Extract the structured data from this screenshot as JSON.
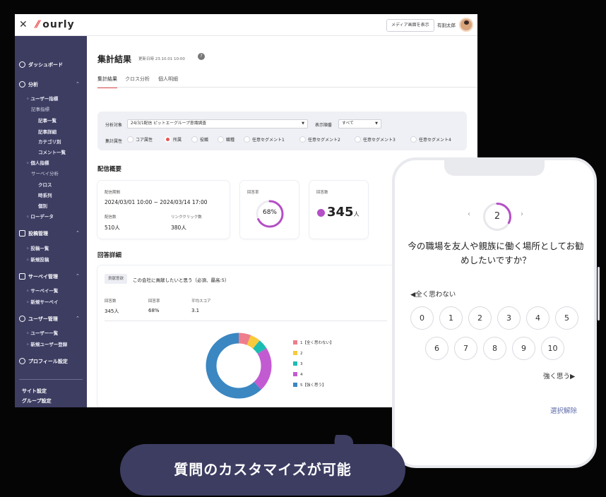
{
  "topbar": {
    "logo_text": "ourly",
    "media_button": "メディア画面を表示",
    "user_name": "有割太郎"
  },
  "sidebar": {
    "dashboard": "ダッシュボード",
    "analysis": "分析",
    "user_metrics": "ユーザー指標",
    "article_metrics": "記事指標",
    "article_list": "記事一覧",
    "article_detail": "記事詳細",
    "by_category": "カテゴリ別",
    "comment_list": "コメント一覧",
    "personal_metrics": "個人指標",
    "survey_analysis": "サーベイ分析",
    "cross": "クロス",
    "time_series": "時系列",
    "individual": "個別",
    "raw_data": "ローデータ",
    "post_mgmt": "投稿管理",
    "post_list": "投稿一覧",
    "new_post": "新規投稿",
    "survey_mgmt": "サーベイ管理",
    "survey_list": "サーベイ一覧",
    "new_survey": "新規サーベイ",
    "user_mgmt": "ユーザー管理",
    "user_list": "ユーザー一覧",
    "new_user": "新規ユーザー登録",
    "profile_settings": "プロフィール設定",
    "site_settings": "サイト設定",
    "group_settings": "グループ設定"
  },
  "main": {
    "title": "集計結果",
    "updated": "更新日時 23.10.01 10:00",
    "help": "?",
    "tabs": [
      "集計結果",
      "クロス分析",
      "個人明細"
    ],
    "filter": {
      "target_label": "分析対象",
      "target_value": "24/3/1配信 ピットエーグループ意識調査",
      "order_label": "表示順番",
      "order_value": "すべて",
      "attr_label": "集計属性",
      "attrs": [
        "コア属性",
        "所属",
        "役職",
        "職種",
        "任意セグメント1",
        "任意セグメント2",
        "任意セグメント3",
        "任意セグメント4"
      ]
    },
    "overview_title": "配信概要",
    "period_label": "配信期間",
    "period_value": "2024/03/01 10:00 ~ 2024/03/14 17:00",
    "sent_label": "配信数",
    "sent_value": "510人",
    "clicks_label": "リンククリック数",
    "clicks_value": "380人",
    "rate_label": "回答率",
    "rate_value": "68%",
    "count_label": "回答数",
    "count_value": "345",
    "count_unit": "人",
    "detail_title": "回答詳細",
    "question_tag": "貢献意欲",
    "question_text": "この会社に貢献したいと思う（必須、最高:5）",
    "d_count_label": "回答数",
    "d_count_value": "345人",
    "d_rate_label": "回答率",
    "d_rate_value": "68%",
    "d_score_label": "平均スコア",
    "d_score_value": "3.1"
  },
  "donut": {
    "legend": [
      "1【全く思わない】",
      "2",
      "3",
      "4",
      "5【強く思う】"
    ],
    "values": [
      6,
      5,
      5,
      22,
      62
    ],
    "colors": [
      "#ee7d8d",
      "#f6ca3c",
      "#1dbcb2",
      "#c25bd1",
      "#3a87c2"
    ]
  },
  "rate_fraction": 0.68,
  "phone": {
    "question_number": "2",
    "prev": "‹",
    "next": "›",
    "question": "今の職場を友人や親族に働く場所としてお勧めしたいですか？",
    "low_label": "◀全く思わない",
    "high_label": "強く思う▶",
    "row1": [
      "0",
      "1",
      "2",
      "3",
      "4",
      "5"
    ],
    "row2": [
      "6",
      "7",
      "8",
      "9",
      "10"
    ],
    "clear": "選択解除"
  },
  "banner_text": "質問のカスタマイズが可能"
}
